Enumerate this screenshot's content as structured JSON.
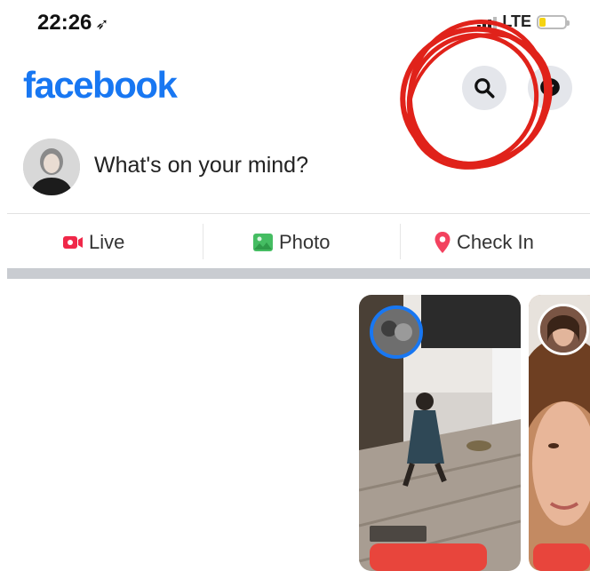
{
  "status_bar": {
    "time": "22:26",
    "location_glyph": "➶",
    "network": "LTE",
    "battery_level_pct": 25
  },
  "header": {
    "logo": "facebook",
    "brand_color": "#1877f2",
    "search_icon": "search-icon",
    "messenger_icon": "messenger-icon"
  },
  "composer": {
    "prompt": "What's on your mind?"
  },
  "actions": {
    "live": "Live",
    "photo": "Photo",
    "check_in": "Check In"
  },
  "colors": {
    "live": "#f02849",
    "photo": "#45bd62",
    "check_in": "#f3425f",
    "annotation": "#e0221a"
  }
}
